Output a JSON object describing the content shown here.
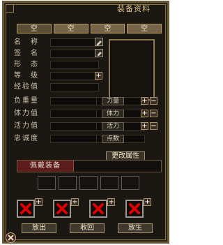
{
  "window": {
    "title": "装备资料"
  },
  "tabs": [
    "空",
    "空",
    "空",
    "空"
  ],
  "fields": [
    {
      "label": "名　称"
    },
    {
      "label": "签　名"
    },
    {
      "label": "形　态"
    },
    {
      "label": "等　级"
    },
    {
      "label": "经验值"
    },
    {
      "label": "负重量",
      "chip": "力量"
    },
    {
      "label": "体力值",
      "chip": "体力"
    },
    {
      "label": "活力值",
      "chip": "活力"
    },
    {
      "label": "忠诚度",
      "chip": "点数"
    }
  ],
  "buttons": {
    "change_attrs": "更改属性",
    "equip_tab": "佩戴装备",
    "bottom": [
      "放出",
      "收回",
      "放生"
    ]
  },
  "ui": {
    "plus": "+",
    "minus": "−"
  },
  "colors": {
    "panel_bg": "#1b1712",
    "frame": "#6a5733",
    "label": "#cfc4ae",
    "x_red": "#e00000"
  },
  "icons": {
    "name_icon": "pencil-icon",
    "sign_icon": "edit-icon",
    "slot_empty": "x-icon"
  }
}
